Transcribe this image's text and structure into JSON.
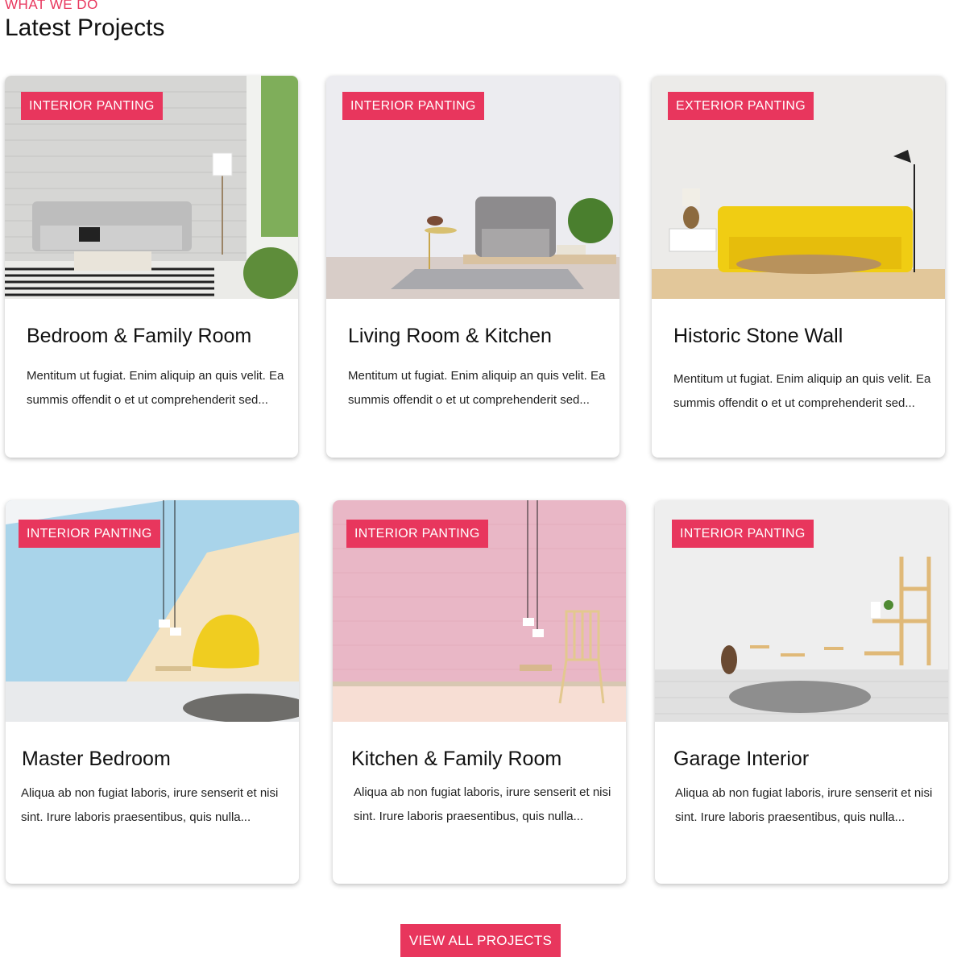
{
  "section": {
    "eyebrow": "WHAT WE DO",
    "title": "Latest Projects"
  },
  "projects": [
    {
      "badge": "INTERIOR PANTING",
      "title": "Bedroom & Family Room",
      "text": "Mentitum ut fugiat. Enim aliquip an quis velit. Ea summis offendit o et ut comprehenderit sed...",
      "image": "living-room-grey-sofa-photo"
    },
    {
      "badge": "INTERIOR PANTING",
      "title": "Living Room & Kitchen",
      "text": "Mentitum ut fugiat. Enim aliquip an quis velit. Ea summis offendit o et ut comprehenderit sed...",
      "image": "grey-armchair-photo"
    },
    {
      "badge": "EXTERIOR PANTING",
      "title": "Historic Stone Wall",
      "text": "Mentitum ut fugiat. Enim aliquip an quis velit. Ea summis offendit o et ut comprehenderit sed...",
      "image": "yellow-sofa-photo"
    },
    {
      "badge": "INTERIOR PANTING",
      "title": "Master Bedroom",
      "text": "Aliqua ab non fugiat laboris, irure senserit et nisi sint. Irure laboris praesentibus, quis nulla...",
      "image": "yellow-chair-blue-wall-photo"
    },
    {
      "badge": "INTERIOR PANTING",
      "title": "Kitchen & Family Room",
      "text": "Aliqua ab non fugiat laboris, irure senserit et nisi sint. Irure laboris praesentibus, quis nulla...",
      "image": "pink-wall-chair-photo"
    },
    {
      "badge": "INTERIOR PANTING",
      "title": "Garage Interior",
      "text": "Aliqua ab non fugiat laboris, irure senserit et nisi sint. Irure laboris praesentibus, quis nulla...",
      "image": "kids-room-shelf-photo"
    }
  ],
  "cta": {
    "label": "VIEW ALL PROJECTS"
  },
  "colors": {
    "accent": "#e8365d",
    "text": "#111111",
    "background": "#ffffff"
  }
}
